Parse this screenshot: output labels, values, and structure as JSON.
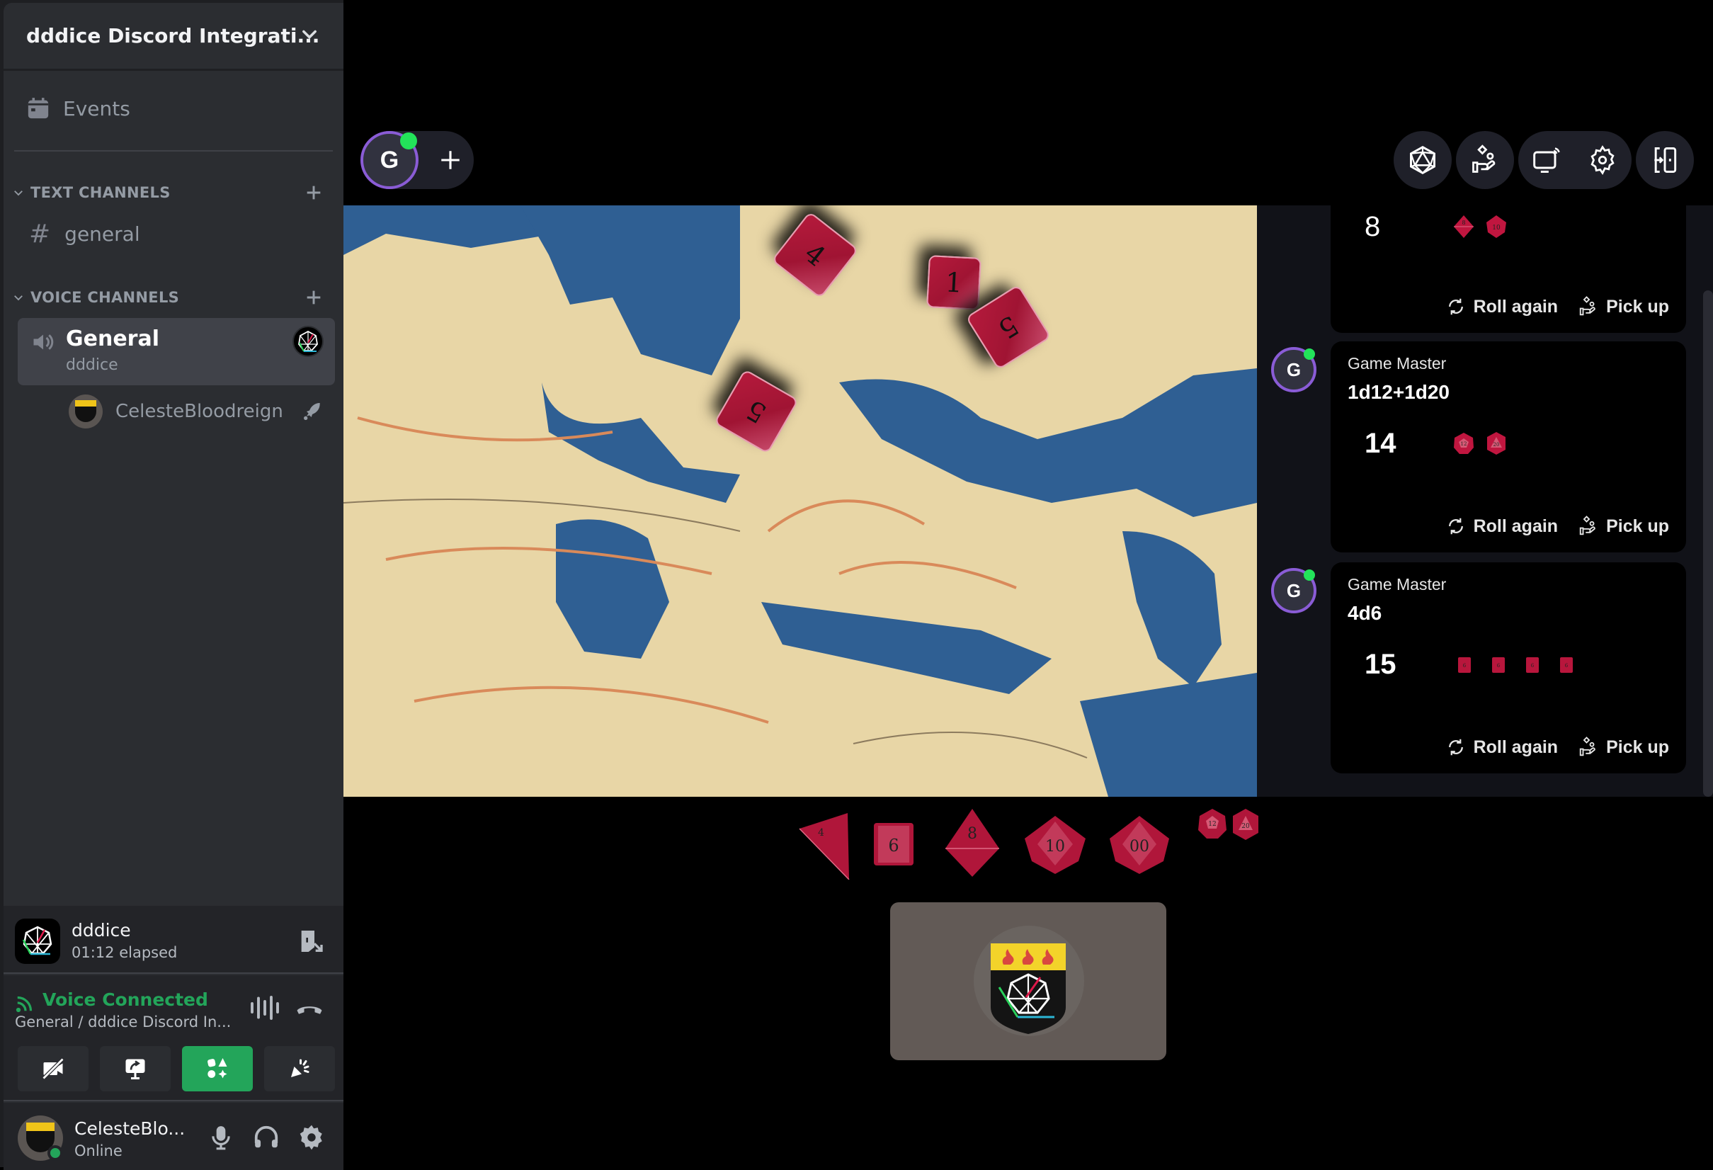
{
  "server": {
    "name": "dddice Discord Integrati...",
    "events_label": "Events",
    "text_category": "TEXT CHANNELS",
    "text_channels": [
      {
        "name": "general"
      }
    ],
    "voice_category": "VOICE CHANNELS",
    "voice_channels": [
      {
        "name": "General",
        "activity": "dddice"
      }
    ],
    "voice_members": [
      {
        "name": "CelesteBloodreign"
      }
    ]
  },
  "activity_panel": {
    "title": "dddice",
    "elapsed": "01:12 elapsed"
  },
  "voice_status": {
    "status": "Voice Connected",
    "location": "General / dddice Discord In..."
  },
  "user": {
    "name": "CelesteBlo...",
    "status": "Online"
  },
  "party": {
    "avatar_initial": "G"
  },
  "top_controls": [
    {
      "icon": "d20-icon",
      "label": "Dice"
    },
    {
      "icon": "pick-up-icon",
      "label": "Pick up"
    },
    {
      "icon": "cast-icon",
      "label": "Cast"
    },
    {
      "icon": "gear-icon",
      "label": "Settings"
    },
    {
      "icon": "exit-icon",
      "label": "Leave"
    }
  ],
  "map_dice": [
    {
      "type": "d6",
      "value": "4"
    },
    {
      "type": "d6",
      "value": "1"
    },
    {
      "type": "d6",
      "value": "5"
    },
    {
      "type": "d6",
      "value": "5"
    }
  ],
  "roll_log": [
    {
      "player": "",
      "initial": "",
      "equation": "",
      "total": "8",
      "dice": [
        {
          "type": "d8",
          "label": "8"
        },
        {
          "type": "d10",
          "label": "10"
        }
      ]
    },
    {
      "player": "Game Master",
      "initial": "G",
      "equation": "1d12+1d20",
      "total": "14",
      "dice": [
        {
          "type": "d12",
          "label": "12"
        },
        {
          "type": "d20",
          "label": "20"
        }
      ]
    },
    {
      "player": "Game Master",
      "initial": "G",
      "equation": "4d6",
      "total": "15",
      "dice": [
        {
          "type": "d6",
          "label": "6"
        },
        {
          "type": "d6",
          "label": "6"
        },
        {
          "type": "d6",
          "label": "6"
        },
        {
          "type": "d6",
          "label": "6"
        }
      ]
    }
  ],
  "roll_actions": {
    "roll_again": "Roll again",
    "pick_up": "Pick up"
  },
  "dice_tray": [
    {
      "type": "d4",
      "label": "4"
    },
    {
      "type": "d6",
      "label": "6"
    },
    {
      "type": "d8",
      "label": "8"
    },
    {
      "type": "d10",
      "label": "10"
    },
    {
      "type": "d10x",
      "label": "00"
    },
    {
      "type": "d12",
      "label": "12"
    },
    {
      "type": "d20",
      "label": "20"
    }
  ],
  "colors": {
    "dice_red": "#b0163a",
    "voice_green": "#23a55a",
    "online_green": "#23e35a",
    "avatar_ring": "#8a5cd6"
  }
}
